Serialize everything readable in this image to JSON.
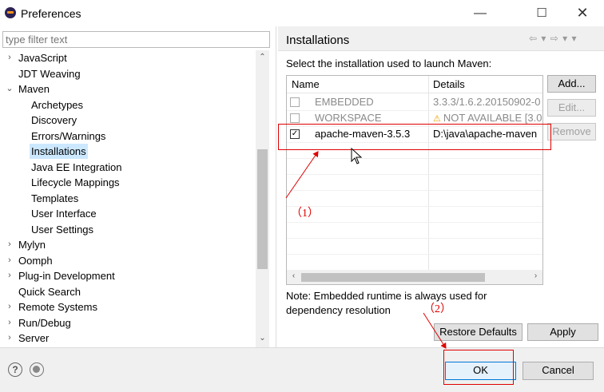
{
  "window": {
    "title": "Preferences",
    "minimize": "—",
    "maximize": "☐",
    "close": "✕"
  },
  "filter": {
    "placeholder": "type filter text"
  },
  "tree": [
    {
      "label": "JavaScript",
      "arrow": "›",
      "level": 0
    },
    {
      "label": "JDT Weaving",
      "arrow": "",
      "level": 0
    },
    {
      "label": "Maven",
      "arrow": "⌄",
      "level": 0
    },
    {
      "label": "Archetypes",
      "arrow": "",
      "level": 1
    },
    {
      "label": "Discovery",
      "arrow": "",
      "level": 1
    },
    {
      "label": "Errors/Warnings",
      "arrow": "",
      "level": 1
    },
    {
      "label": "Installations",
      "arrow": "",
      "level": 1,
      "selected": true
    },
    {
      "label": "Java EE Integration",
      "arrow": "",
      "level": 1
    },
    {
      "label": "Lifecycle Mappings",
      "arrow": "",
      "level": 1
    },
    {
      "label": "Templates",
      "arrow": "",
      "level": 1
    },
    {
      "label": "User Interface",
      "arrow": "",
      "level": 1
    },
    {
      "label": "User Settings",
      "arrow": "",
      "level": 1
    },
    {
      "label": "Mylyn",
      "arrow": "›",
      "level": 0
    },
    {
      "label": "Oomph",
      "arrow": "›",
      "level": 0
    },
    {
      "label": "Plug-in Development",
      "arrow": "›",
      "level": 0
    },
    {
      "label": "Quick Search",
      "arrow": "",
      "level": 0
    },
    {
      "label": "Remote Systems",
      "arrow": "›",
      "level": 0
    },
    {
      "label": "Run/Debug",
      "arrow": "›",
      "level": 0
    },
    {
      "label": "Server",
      "arrow": "›",
      "level": 0
    }
  ],
  "page": {
    "title": "Installations",
    "nav": "⇦ ▾ ⇨ ▾ ▾",
    "intro": "Select the installation used to launch Maven:",
    "columns": {
      "name": "Name",
      "details": "Details"
    },
    "rows": [
      {
        "name": "EMBEDDED",
        "details": "3.3.3/1.6.2.20150902-0",
        "checked": false,
        "disabled": true
      },
      {
        "name": "WORKSPACE",
        "details": "NOT AVAILABLE [3.0",
        "checked": false,
        "disabled": true,
        "warning": true
      },
      {
        "name": "apache-maven-3.5.3",
        "details": "D:\\java\\apache-maven",
        "checked": true,
        "disabled": false
      }
    ],
    "note": "Note: Embedded runtime is always used for dependency resolution"
  },
  "buttons": {
    "add": "Add...",
    "edit": "Edit...",
    "remove": "Remove",
    "restore_defaults": "Restore Defaults",
    "apply": "Apply",
    "ok": "OK",
    "cancel": "Cancel"
  },
  "annotations": {
    "one": "（1）",
    "two": "（2）"
  },
  "colors": {
    "annotation": "#e00000",
    "selection": "#cce8ff",
    "focus": "#0078d7"
  }
}
